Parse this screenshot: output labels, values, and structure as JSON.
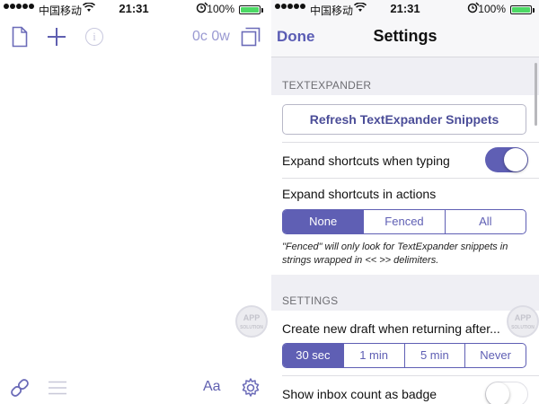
{
  "status_bar": {
    "carrier": "中国移动",
    "time": "21:31",
    "battery": "100%"
  },
  "editor": {
    "word_count": "0c 0w",
    "icons": {
      "new_document": "document-icon",
      "add": "plus-icon",
      "info": "info-icon",
      "expand": "expand-icon",
      "link": "link-icon",
      "menu": "hamburger-menu-icon",
      "font": "font-size-icon",
      "settings": "gear-icon"
    },
    "info_glyph": "i",
    "font_label": "Aa"
  },
  "settings": {
    "nav": {
      "done": "Done",
      "title": "Settings"
    },
    "textexpander": {
      "header": "TEXTEXPANDER",
      "refresh_button": "Refresh TextExpander Snippets",
      "expand_typing_label": "Expand shortcuts when typing",
      "expand_typing_on": true,
      "expand_actions_label": "Expand shortcuts in actions",
      "expand_actions_options": [
        "None",
        "Fenced",
        "All"
      ],
      "expand_actions_selected": "None",
      "note": "\"Fenced\" will only look for TextExpander snippets in strings wrapped in << >> delimiters."
    },
    "general": {
      "header": "SETTINGS",
      "new_draft_label": "Create new draft when returning after...",
      "new_draft_options": [
        "30 sec",
        "1 min",
        "5 min",
        "Never"
      ],
      "new_draft_selected": "30 sec",
      "inbox_badge_label": "Show inbox count as badge",
      "inbox_badge_on": false
    }
  },
  "watermark": {
    "line1": "APP",
    "line2": "SOLUTION"
  },
  "colors": {
    "accent": "#5f5fb4",
    "toggle_on": "#5f5fb4",
    "battery": "#4cd964",
    "grouped_background": "#efeff4"
  }
}
